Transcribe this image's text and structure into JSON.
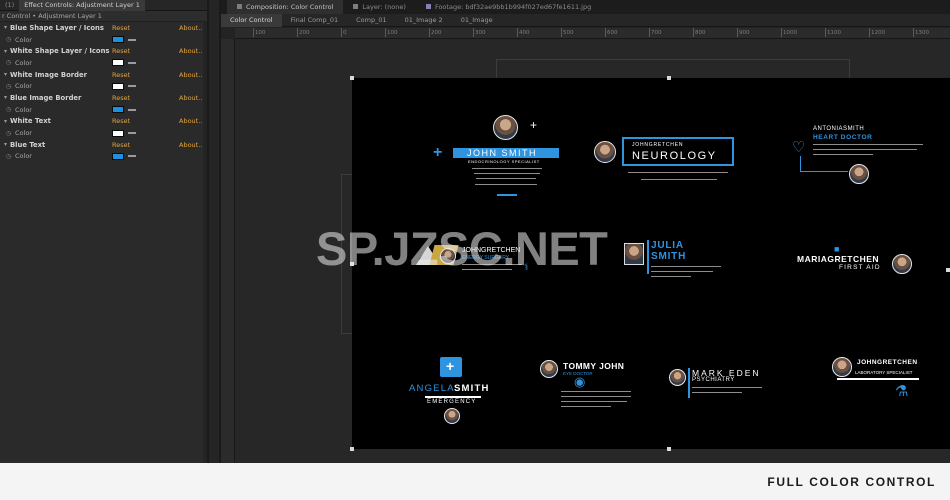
{
  "effect_controls": {
    "tab_left": "(1)",
    "tab_title": "Effect Controls: Adjustment Layer 1",
    "breadcrumb": "r Control • Adjustment Layer 1",
    "reset_label": "Reset",
    "about_label": "About...",
    "property_label": "Color",
    "effects": [
      {
        "name": "Blue Shape Layer / Icons",
        "color": "#1e90e0"
      },
      {
        "name": "White Shape Layer / Icons",
        "color": "#ffffff"
      },
      {
        "name": "White Image Border",
        "color": "#ffffff"
      },
      {
        "name": "Blue Image Border",
        "color": "#1e90e0"
      },
      {
        "name": "White Text",
        "color": "#ffffff"
      },
      {
        "name": "Blue Text",
        "color": "#1e90e0"
      }
    ]
  },
  "viewer": {
    "tabs": [
      {
        "label": "Composition: Color Control",
        "active": true
      },
      {
        "label": "Layer: (none)",
        "active": false
      },
      {
        "label": "Footage: bdf32ae9bb1b994f027ed67fe1611.jpg",
        "active": false
      }
    ],
    "subtabs": [
      "Color Control",
      "Final Comp_01",
      "Comp_01",
      "01_Image 2",
      "01_Image"
    ],
    "ruler_ticks": [
      "100",
      "200",
      "0",
      "100",
      "200",
      "300",
      "400",
      "500",
      "600",
      "700",
      "800",
      "900",
      "1000",
      "1100",
      "1200",
      "1300",
      "1400"
    ]
  },
  "composition": {
    "john": {
      "name": "JOHN SMITH",
      "role": "ENDOCRINOLOGY SPECIALIST"
    },
    "neurology": {
      "name": "JOHNGRETCHEN",
      "dept": "NEUROLOGY"
    },
    "antonia": {
      "name": "ANTONIASMITH",
      "role": "HEART DOCTOR"
    },
    "julia": {
      "first": "JULIA",
      "last": "SMITH"
    },
    "jasmine": {
      "name": "JOHNGRETCHEN",
      "role": "ENERGY SURGERY"
    },
    "maria": {
      "name": "MARIAGRETCHEN",
      "role": "FIRST AID"
    },
    "angela": {
      "first": "ANGELA",
      "last": "SMITH",
      "role": "EMERGENCY"
    },
    "tommy": {
      "name": "TOMMY JOHN",
      "role": "EYE DOCTOR"
    },
    "mark": {
      "name": "MARK EDEN",
      "role": "PSYCHIATRY"
    },
    "lab": {
      "name": "JOHNGRETCHEN",
      "role": "LABORATORY SPECIALIST"
    }
  },
  "watermark": "SP.JZSC.NET",
  "footer": {
    "title": "FULL COLOR CONTROL"
  }
}
